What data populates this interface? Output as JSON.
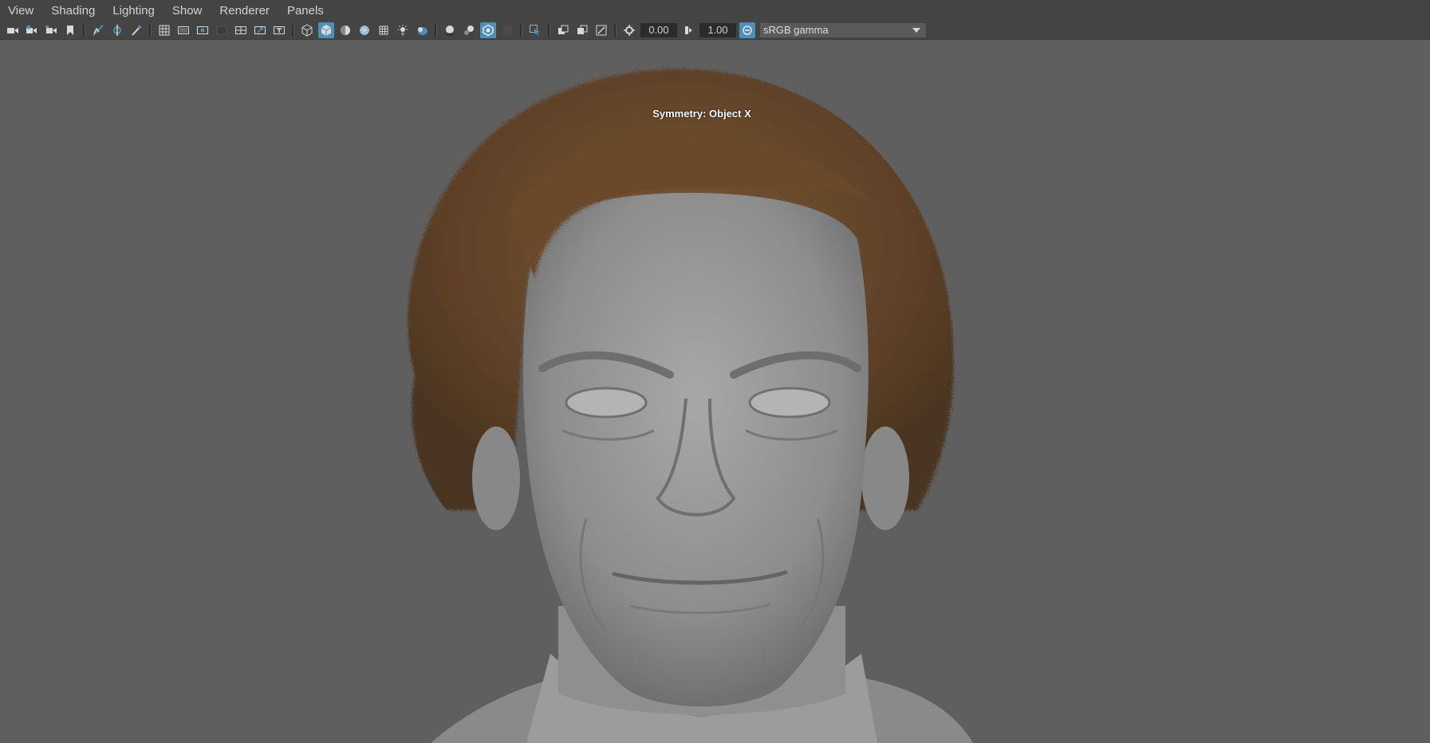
{
  "menu": {
    "items": [
      {
        "label": "View"
      },
      {
        "label": "Shading"
      },
      {
        "label": "Lighting"
      },
      {
        "label": "Show"
      },
      {
        "label": "Renderer"
      },
      {
        "label": "Panels"
      }
    ]
  },
  "toolbar": {
    "icons": [
      "camera-icon",
      "camera-attributes-icon",
      "camera-bookmark-icon",
      "bookmark-icon",
      "image-plane-icon",
      "grease-pencil-icon",
      "two-d-pan-zoom-icon",
      "grid-icon",
      "film-gate-icon",
      "resolution-gate-icon",
      "gate-mask-icon",
      "field-chart-icon",
      "safe-action-icon",
      "safe-title-icon",
      "wireframe-icon",
      "smooth-shade-icon",
      "wireframe-on-shaded-icon",
      "textured-icon",
      "use-all-lights-icon",
      "shadows-icon",
      "screen-space-ao-icon",
      "motion-blur-icon",
      "anti-aliasing-icon",
      "depth-of-field-icon",
      "isolate-select-icon",
      "xray-icon",
      "xray-joints-icon",
      "xray-components-icon",
      "exposure-icon",
      "gamma-icon",
      "color-management-icon"
    ],
    "exposure_value": "0.00",
    "gamma_value": "1.00",
    "color_space": "sRGB gamma"
  },
  "viewport": {
    "overlay_text": "Symmetry: Object X",
    "background_color": "#5f5f5f",
    "model_description_colors": {
      "skin": "#9a9a9a",
      "hair": "#6b4a2c"
    }
  }
}
